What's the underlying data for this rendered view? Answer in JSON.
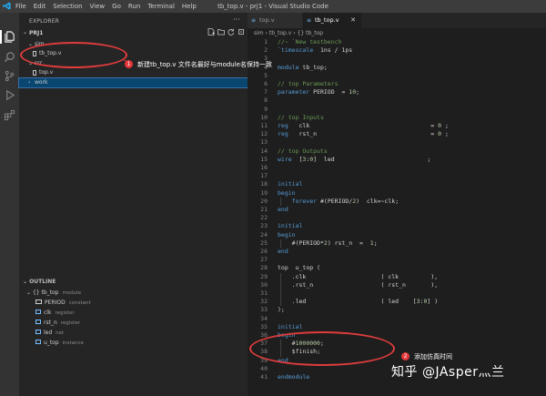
{
  "titlebar": {
    "menu": [
      "File",
      "Edit",
      "Selection",
      "View",
      "Go",
      "Run",
      "Terminal",
      "Help"
    ],
    "window_title": "tb_top.v - prj1 - Visual Studio Code"
  },
  "sidebar": {
    "header": "EXPLORER",
    "project": "PRJ1",
    "tree": [
      {
        "label": "sim",
        "type": "folder"
      },
      {
        "label": "tb_top.v",
        "type": "file"
      },
      {
        "label": "src",
        "type": "folder"
      },
      {
        "label": "top.v",
        "type": "file"
      },
      {
        "label": "work",
        "type": "folder"
      }
    ]
  },
  "outline": {
    "header": "OUTLINE",
    "items": [
      {
        "label": "tb_top",
        "desc": "module"
      },
      {
        "label": "PERIOD",
        "desc": "constant"
      },
      {
        "label": "clk",
        "desc": "register"
      },
      {
        "label": "rst_n",
        "desc": "register"
      },
      {
        "label": "led",
        "desc": "net"
      },
      {
        "label": "u_top",
        "desc": "instance"
      }
    ]
  },
  "editor": {
    "tabs": [
      {
        "label": "top.v",
        "active": false
      },
      {
        "label": "tb_top.v",
        "active": true
      }
    ],
    "breadcrumb": [
      "sim",
      "tb_top.v",
      "{} tb_top"
    ],
    "lines": [
      {
        "n": "1",
        "text": "//~ `New testbench"
      },
      {
        "n": "2",
        "text": "`timescale  1ns / 1ps"
      },
      {
        "n": "3",
        "text": ""
      },
      {
        "n": "4",
        "text": "module tb_top;"
      },
      {
        "n": "5",
        "text": ""
      },
      {
        "n": "6",
        "text": "// top Parameters"
      },
      {
        "n": "7",
        "text": "parameter PERIOD  = 10;"
      },
      {
        "n": "8",
        "text": ""
      },
      {
        "n": "9",
        "text": ""
      },
      {
        "n": "10",
        "text": "// top Inputs"
      },
      {
        "n": "11",
        "text": "reg   clk                                  = 0 ;"
      },
      {
        "n": "12",
        "text": "reg   rst_n                                = 0 ;"
      },
      {
        "n": "13",
        "text": ""
      },
      {
        "n": "14",
        "text": "// top Outputs"
      },
      {
        "n": "15",
        "text": "wire  [3:0]  led                          ;"
      },
      {
        "n": "16",
        "text": ""
      },
      {
        "n": "17",
        "text": ""
      },
      {
        "n": "18",
        "text": "initial"
      },
      {
        "n": "19",
        "text": "begin"
      },
      {
        "n": "20",
        "text": "    forever #(PERIOD/2)  clk=~clk;"
      },
      {
        "n": "21",
        "text": "end"
      },
      {
        "n": "22",
        "text": ""
      },
      {
        "n": "23",
        "text": "initial"
      },
      {
        "n": "24",
        "text": "begin"
      },
      {
        "n": "25",
        "text": "    #(PERIOD*2) rst_n  =  1;"
      },
      {
        "n": "26",
        "text": "end"
      },
      {
        "n": "27",
        "text": ""
      },
      {
        "n": "28",
        "text": "top  u_top ("
      },
      {
        "n": "29",
        "text": "    .clk                     ( clk         ),"
      },
      {
        "n": "30",
        "text": "    .rst_n                   ( rst_n       ),"
      },
      {
        "n": "31",
        "text": ""
      },
      {
        "n": "32",
        "text": "    .led                     ( led    [3:0] )"
      },
      {
        "n": "33",
        "text": ");"
      },
      {
        "n": "34",
        "text": ""
      },
      {
        "n": "35",
        "text": "initial"
      },
      {
        "n": "36",
        "text": "begin"
      },
      {
        "n": "37",
        "text": "    #1000000;"
      },
      {
        "n": "38",
        "text": "    $finish;"
      },
      {
        "n": "39",
        "text": "end"
      },
      {
        "n": "40",
        "text": ""
      },
      {
        "n": "41",
        "text": "endmodule"
      }
    ]
  },
  "annotations": [
    {
      "badge": "1",
      "text": "新建tb_top.v  文件名最好与module名保持一致"
    },
    {
      "badge": "2",
      "text": "添加仿真时间"
    }
  ],
  "watermark": "知乎 @JAsper灬兰",
  "colors": {
    "titlebar": "#3c3c3c",
    "activity_bar": "#333333",
    "sidebar": "#252526",
    "editor": "#1e1e1e",
    "selection": "#094771",
    "annotation_red": "#e03c3c",
    "comment": "#6a9955",
    "keyword": "#569cd6",
    "number": "#b5cea8"
  }
}
